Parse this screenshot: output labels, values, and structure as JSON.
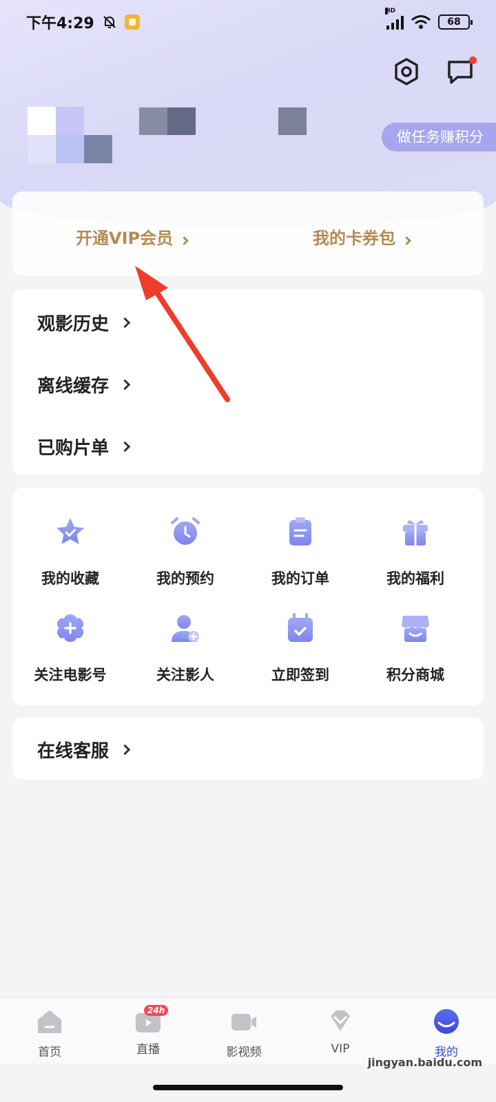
{
  "status_bar": {
    "time": "下午4:29",
    "signal_label": "HD",
    "battery": "68"
  },
  "header": {
    "task_button": "做任务赚积分",
    "icons": [
      "settings-icon",
      "message-icon"
    ]
  },
  "vip_card": {
    "open_vip": "开通VIP会员",
    "coupons": "我的卡券包"
  },
  "list": [
    {
      "label": "观影历史"
    },
    {
      "label": "离线缓存"
    },
    {
      "label": "已购片单"
    }
  ],
  "grid": [
    {
      "label": "我的收藏",
      "icon": "star-icon"
    },
    {
      "label": "我的预约",
      "icon": "alarm-clock-icon"
    },
    {
      "label": "我的订单",
      "icon": "clipboard-icon"
    },
    {
      "label": "我的福利",
      "icon": "gift-icon"
    },
    {
      "label": "关注电影号",
      "icon": "plus-flower-icon"
    },
    {
      "label": "关注影人",
      "icon": "add-person-icon"
    },
    {
      "label": "立即签到",
      "icon": "calendar-check-icon"
    },
    {
      "label": "积分商城",
      "icon": "store-icon"
    }
  ],
  "service": {
    "label": "在线客服"
  },
  "tabbar": [
    {
      "label": "首页",
      "icon": "home-icon"
    },
    {
      "label": "直播",
      "icon": "tv-live-icon",
      "badge": "24h"
    },
    {
      "label": "影视频",
      "icon": "video-camera-icon"
    },
    {
      "label": "VIP",
      "icon": "diamond-icon"
    },
    {
      "label": "我的",
      "icon": "profile-icon"
    }
  ],
  "watermark": "jingyan.baidu.com",
  "colors": {
    "accent_gold": "#b48b52",
    "icon_purple": "#8f93ee",
    "pill": "#a6a6ee",
    "arrow_red": "#ee3d2b"
  }
}
